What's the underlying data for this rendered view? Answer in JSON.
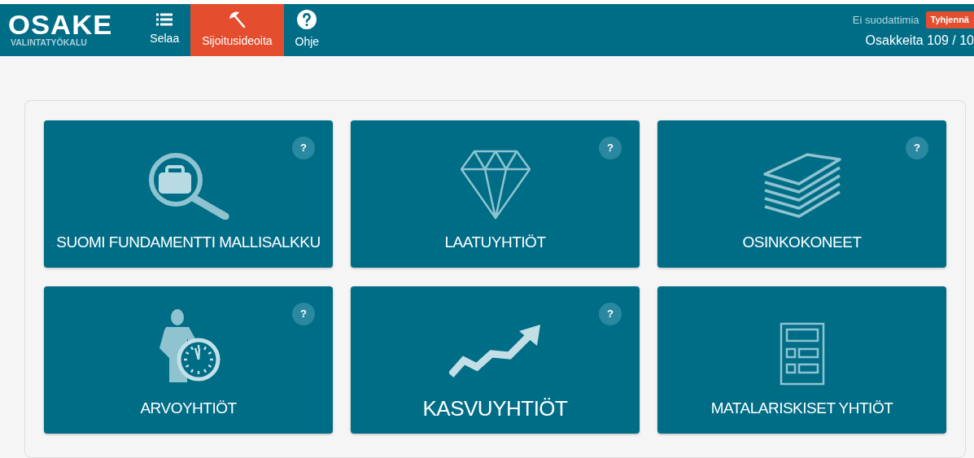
{
  "header": {
    "logo": {
      "title": "OSAKE",
      "subtitle": "VALINTATYÖKALU"
    },
    "nav": [
      {
        "label": "Selaa",
        "selected": false
      },
      {
        "label": "Sijoitusideoita",
        "selected": true
      },
      {
        "label": "Ohje",
        "selected": false
      }
    ],
    "filter_status": "Ei suodattimia",
    "clear_button": "Tyhjennä",
    "count": "Osakkeita 109 / 10"
  },
  "cards": [
    {
      "title": "SUOMI FUNDAMENTTI MALLISALKKU",
      "help": "?",
      "emphasized": false
    },
    {
      "title": "LAATUYHTIÖT",
      "help": "?",
      "emphasized": false
    },
    {
      "title": "OSINKOKONEET",
      "help": "?",
      "emphasized": false
    },
    {
      "title": "ARVOYHTIÖT",
      "help": "?",
      "emphasized": false
    },
    {
      "title": "KASVUYHTIÖT",
      "help": "?",
      "emphasized": true
    },
    {
      "title": "MATALARISKISET YHTIÖT",
      "emphasized": false
    }
  ]
}
